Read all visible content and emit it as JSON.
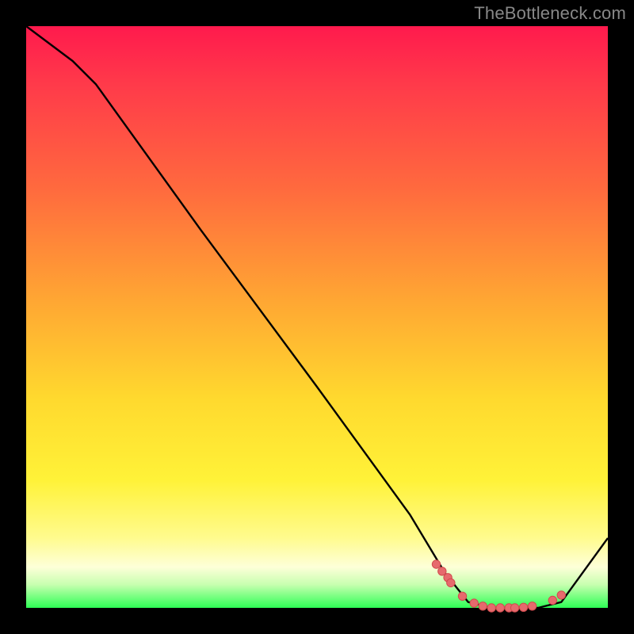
{
  "watermark": "TheBottleneck.com",
  "colors": {
    "background": "#000000",
    "curve_stroke": "#000000",
    "marker_fill": "#e66a6d",
    "marker_stroke": "#d24a4d",
    "gradient_stops": [
      "#ff1a4d",
      "#ff6a3e",
      "#ffd92e",
      "#fffb8e",
      "#fdffd8",
      "#2eff55"
    ]
  },
  "chart_data": {
    "type": "line",
    "title": "",
    "xlabel": "",
    "ylabel": "",
    "xlim": [
      0,
      100
    ],
    "ylim": [
      0,
      100
    ],
    "curve": {
      "x": [
        0,
        8,
        12,
        30,
        50,
        66,
        72,
        76,
        80,
        84,
        88,
        92,
        100
      ],
      "y": [
        100,
        94,
        90,
        65,
        38,
        16,
        6,
        1,
        0,
        0,
        0,
        1,
        12
      ]
    },
    "markers": {
      "comment": "points highlighted near the bottom of the valley",
      "x": [
        70.5,
        71.5,
        72.5,
        73,
        75,
        77,
        78.5,
        80,
        81.5,
        83,
        84,
        85.5,
        87,
        90.5,
        92
      ],
      "y": [
        7.5,
        6.3,
        5.2,
        4.3,
        2.0,
        0.8,
        0.3,
        0.0,
        0.0,
        0.0,
        0.0,
        0.1,
        0.3,
        1.3,
        2.2
      ]
    }
  }
}
